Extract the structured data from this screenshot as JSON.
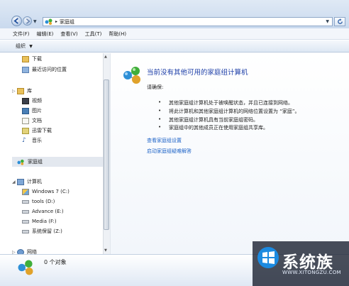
{
  "address": {
    "crumb": "家庭组"
  },
  "menu": [
    "文件(F)",
    "编辑(E)",
    "查看(V)",
    "工具(T)",
    "帮助(H)"
  ],
  "toolbar": {
    "organize": "组织"
  },
  "nav": {
    "downloads": "下载",
    "recent": "最近访问的位置",
    "libraries": "库",
    "videos": "视频",
    "pictures": "图片",
    "documents": "文档",
    "thunder": "迅雷下载",
    "music": "音乐",
    "homegroup": "家庭组",
    "computer": "计算机",
    "drives": [
      "Windows 7  (C:)",
      "tools  (D:)",
      "Advance  (E:)",
      "Media  (F:)",
      "系统保留  (Z:)"
    ],
    "network": "网络"
  },
  "content": {
    "heading": "当前没有其他可用的家庭组计算机",
    "intro": "请确保:",
    "bullets": [
      "其他家庭组计算机处于被唤醒状态，并且已连接到网络。",
      "将此计算机和其他家庭组计算机的网络位置设置为 “家庭”。",
      "其他家庭组计算机具有当前家庭组密码。",
      "家庭组中的其他成员正在使用家庭组共享库。"
    ],
    "links": [
      "查看家庭组设置",
      "启动家庭组疑难解答"
    ]
  },
  "status": {
    "count": "0 个对象"
  },
  "watermark": {
    "brand": "系统族",
    "url": "WWW.XITONGZU.COM"
  }
}
